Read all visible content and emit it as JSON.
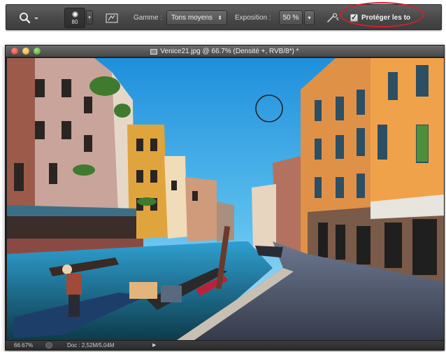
{
  "options_bar": {
    "brush_size": "80",
    "range_label": "Gamme :",
    "range_value": "Tons moyens",
    "exposure_label": "Exposition :",
    "exposure_value": "50 %",
    "protect_tones_label": "Protéger les to",
    "protect_tones_checked": true
  },
  "document": {
    "title": "Venice21.jpg @ 66.7% (Densité +, RVB/8*) *"
  },
  "status_bar": {
    "zoom": "66.67%",
    "doc_info": "Doc : 2,52M/5,04M"
  },
  "colors": {
    "annotation_ring": "#d3202a",
    "toolbar_bg": "#4a4a4a",
    "sky": "#3fa6e6"
  }
}
